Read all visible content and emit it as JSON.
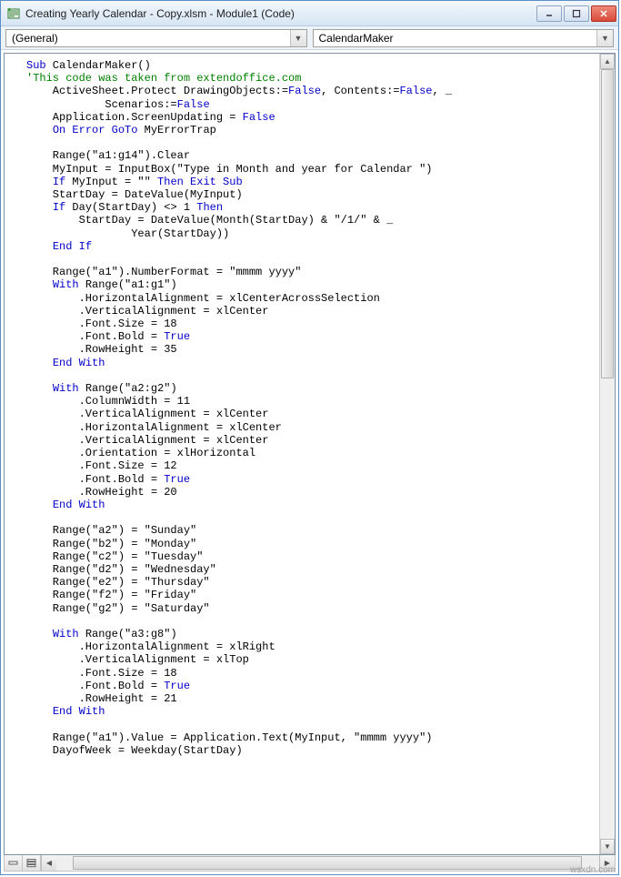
{
  "window": {
    "title": "Creating Yearly Calendar - Copy.xlsm - Module1 (Code)"
  },
  "dropdowns": {
    "left": "(General)",
    "right": "CalendarMaker"
  },
  "code": {
    "lines": [
      {
        "i": 0,
        "seg": [
          [
            "kw",
            "Sub"
          ],
          [
            "p",
            " CalendarMaker()"
          ]
        ]
      },
      {
        "i": 0,
        "seg": [
          [
            "cm",
            "'This code was taken from extendoffice.com"
          ]
        ]
      },
      {
        "i": 1,
        "seg": [
          [
            "p",
            "ActiveSheet.Protect DrawingObjects:="
          ],
          [
            "kw",
            "False"
          ],
          [
            "p",
            ", Contents:="
          ],
          [
            "kw",
            "False"
          ],
          [
            "p",
            ", _"
          ]
        ]
      },
      {
        "i": 3,
        "seg": [
          [
            "p",
            "Scenarios:="
          ],
          [
            "kw",
            "False"
          ]
        ]
      },
      {
        "i": 1,
        "seg": [
          [
            "p",
            "Application.ScreenUpdating = "
          ],
          [
            "kw",
            "False"
          ]
        ]
      },
      {
        "i": 1,
        "seg": [
          [
            "kw",
            "On Error GoTo"
          ],
          [
            "p",
            " MyErrorTrap"
          ]
        ]
      },
      {
        "i": 0,
        "seg": [
          [
            "p",
            ""
          ]
        ]
      },
      {
        "i": 1,
        "seg": [
          [
            "p",
            "Range(\"a1:g14\").Clear"
          ]
        ]
      },
      {
        "i": 1,
        "seg": [
          [
            "p",
            "MyInput = InputBox(\"Type in Month and year for Calendar \")"
          ]
        ]
      },
      {
        "i": 1,
        "seg": [
          [
            "kw",
            "If"
          ],
          [
            "p",
            " MyInput = \"\" "
          ],
          [
            "kw",
            "Then Exit Sub"
          ]
        ]
      },
      {
        "i": 1,
        "seg": [
          [
            "p",
            "StartDay = DateValue(MyInput)"
          ]
        ]
      },
      {
        "i": 1,
        "seg": [
          [
            "kw",
            "If"
          ],
          [
            "p",
            " Day(StartDay) <> 1 "
          ],
          [
            "kw",
            "Then"
          ]
        ]
      },
      {
        "i": 2,
        "seg": [
          [
            "p",
            "StartDay = DateValue(Month(StartDay) & \"/1/\" & _"
          ]
        ]
      },
      {
        "i": 4,
        "seg": [
          [
            "p",
            "Year(StartDay))"
          ]
        ]
      },
      {
        "i": 1,
        "seg": [
          [
            "kw",
            "End If"
          ]
        ]
      },
      {
        "i": 0,
        "seg": [
          [
            "p",
            ""
          ]
        ]
      },
      {
        "i": 1,
        "seg": [
          [
            "p",
            "Range(\"a1\").NumberFormat = \"mmmm yyyy\""
          ]
        ]
      },
      {
        "i": 1,
        "seg": [
          [
            "kw",
            "With"
          ],
          [
            "p",
            " Range(\"a1:g1\")"
          ]
        ]
      },
      {
        "i": 2,
        "seg": [
          [
            "p",
            ".HorizontalAlignment = xlCenterAcrossSelection"
          ]
        ]
      },
      {
        "i": 2,
        "seg": [
          [
            "p",
            ".VerticalAlignment = xlCenter"
          ]
        ]
      },
      {
        "i": 2,
        "seg": [
          [
            "p",
            ".Font.Size = 18"
          ]
        ]
      },
      {
        "i": 2,
        "seg": [
          [
            "p",
            ".Font.Bold = "
          ],
          [
            "kw",
            "True"
          ]
        ]
      },
      {
        "i": 2,
        "seg": [
          [
            "p",
            ".RowHeight = 35"
          ]
        ]
      },
      {
        "i": 1,
        "seg": [
          [
            "kw",
            "End With"
          ]
        ]
      },
      {
        "i": 0,
        "seg": [
          [
            "p",
            ""
          ]
        ]
      },
      {
        "i": 1,
        "seg": [
          [
            "kw",
            "With"
          ],
          [
            "p",
            " Range(\"a2:g2\")"
          ]
        ]
      },
      {
        "i": 2,
        "seg": [
          [
            "p",
            ".ColumnWidth = 11"
          ]
        ]
      },
      {
        "i": 2,
        "seg": [
          [
            "p",
            ".VerticalAlignment = xlCenter"
          ]
        ]
      },
      {
        "i": 2,
        "seg": [
          [
            "p",
            ".HorizontalAlignment = xlCenter"
          ]
        ]
      },
      {
        "i": 2,
        "seg": [
          [
            "p",
            ".VerticalAlignment = xlCenter"
          ]
        ]
      },
      {
        "i": 2,
        "seg": [
          [
            "p",
            ".Orientation = xlHorizontal"
          ]
        ]
      },
      {
        "i": 2,
        "seg": [
          [
            "p",
            ".Font.Size = 12"
          ]
        ]
      },
      {
        "i": 2,
        "seg": [
          [
            "p",
            ".Font.Bold = "
          ],
          [
            "kw",
            "True"
          ]
        ]
      },
      {
        "i": 2,
        "seg": [
          [
            "p",
            ".RowHeight = 20"
          ]
        ]
      },
      {
        "i": 1,
        "seg": [
          [
            "kw",
            "End With"
          ]
        ]
      },
      {
        "i": 0,
        "seg": [
          [
            "p",
            ""
          ]
        ]
      },
      {
        "i": 1,
        "seg": [
          [
            "p",
            "Range(\"a2\") = \"Sunday\""
          ]
        ]
      },
      {
        "i": 1,
        "seg": [
          [
            "p",
            "Range(\"b2\") = \"Monday\""
          ]
        ]
      },
      {
        "i": 1,
        "seg": [
          [
            "p",
            "Range(\"c2\") = \"Tuesday\""
          ]
        ]
      },
      {
        "i": 1,
        "seg": [
          [
            "p",
            "Range(\"d2\") = \"Wednesday\""
          ]
        ]
      },
      {
        "i": 1,
        "seg": [
          [
            "p",
            "Range(\"e2\") = \"Thursday\""
          ]
        ]
      },
      {
        "i": 1,
        "seg": [
          [
            "p",
            "Range(\"f2\") = \"Friday\""
          ]
        ]
      },
      {
        "i": 1,
        "seg": [
          [
            "p",
            "Range(\"g2\") = \"Saturday\""
          ]
        ]
      },
      {
        "i": 0,
        "seg": [
          [
            "p",
            ""
          ]
        ]
      },
      {
        "i": 1,
        "seg": [
          [
            "kw",
            "With"
          ],
          [
            "p",
            " Range(\"a3:g8\")"
          ]
        ]
      },
      {
        "i": 2,
        "seg": [
          [
            "p",
            ".HorizontalAlignment = xlRight"
          ]
        ]
      },
      {
        "i": 2,
        "seg": [
          [
            "p",
            ".VerticalAlignment = xlTop"
          ]
        ]
      },
      {
        "i": 2,
        "seg": [
          [
            "p",
            ".Font.Size = 18"
          ]
        ]
      },
      {
        "i": 2,
        "seg": [
          [
            "p",
            ".Font.Bold = "
          ],
          [
            "kw",
            "True"
          ]
        ]
      },
      {
        "i": 2,
        "seg": [
          [
            "p",
            ".RowHeight = 21"
          ]
        ]
      },
      {
        "i": 1,
        "seg": [
          [
            "kw",
            "End With"
          ]
        ]
      },
      {
        "i": 0,
        "seg": [
          [
            "p",
            ""
          ]
        ]
      },
      {
        "i": 1,
        "seg": [
          [
            "p",
            "Range(\"a1\").Value = Application.Text(MyInput, \"mmmm yyyy\")"
          ]
        ]
      },
      {
        "i": 1,
        "seg": [
          [
            "p",
            "DayofWeek = Weekday(StartDay)"
          ]
        ]
      }
    ]
  },
  "watermark": "wsxdn.com"
}
